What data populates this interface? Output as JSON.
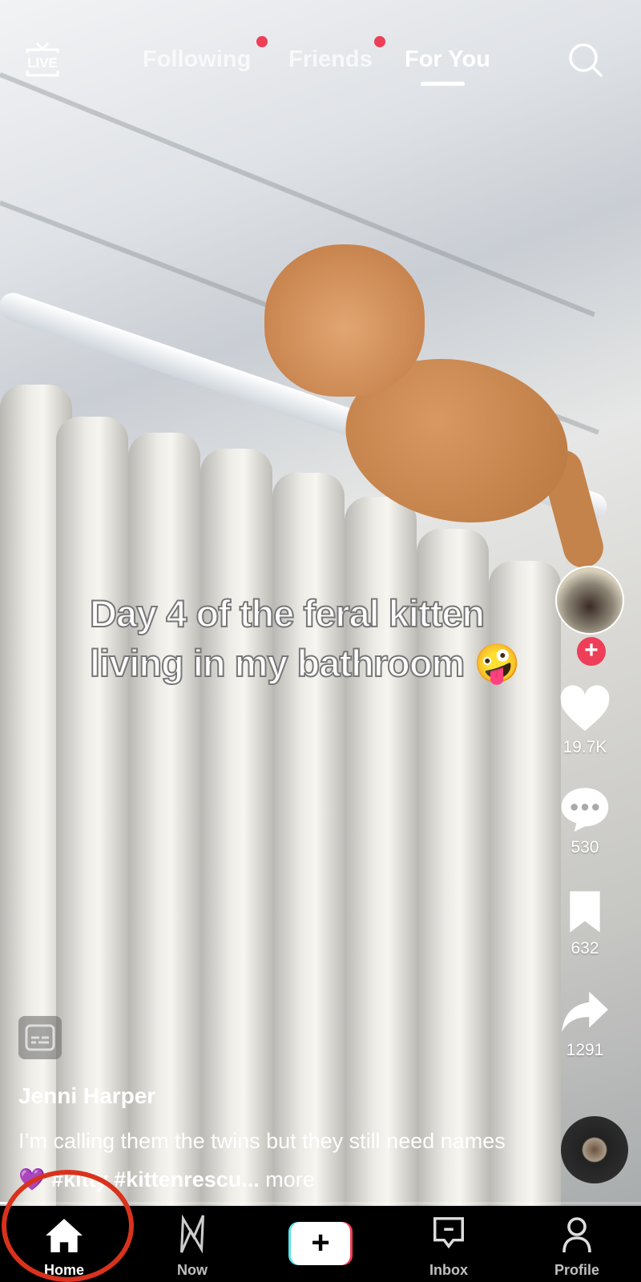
{
  "header": {
    "live_label": "LIVE",
    "tabs": [
      {
        "label": "Following",
        "notification_dot": true,
        "active": false
      },
      {
        "label": "Friends",
        "notification_dot": true,
        "active": false
      },
      {
        "label": "For You",
        "notification_dot": false,
        "active": true
      }
    ],
    "search_icon": "search-icon"
  },
  "video": {
    "overlay_text_line1": "Day 4 of the feral kitten",
    "overlay_text_line2": "living in my bathroom 🤪",
    "progress_percent": 2
  },
  "actions": {
    "likes": "19.7K",
    "comments": "530",
    "saves": "632",
    "shares": "1291"
  },
  "post": {
    "username": "Jenni Harper",
    "description": "I’m calling them the twins but they still need names 💜 ",
    "hashtags": "#kitty #kittenrescu...",
    "more_label": "more"
  },
  "nav": {
    "items": [
      {
        "label": "Home",
        "icon": "home-icon",
        "active": true
      },
      {
        "label": "Now",
        "icon": "now-icon",
        "active": false
      },
      {
        "label": "",
        "icon": "create-plus-icon",
        "active": false
      },
      {
        "label": "Inbox",
        "icon": "inbox-icon",
        "active": false
      },
      {
        "label": "Profile",
        "icon": "profile-icon",
        "active": false
      }
    ]
  },
  "colors": {
    "accent": "#ee3e58",
    "annotation_ring": "#d9321c",
    "nav_bg": "#000000"
  }
}
